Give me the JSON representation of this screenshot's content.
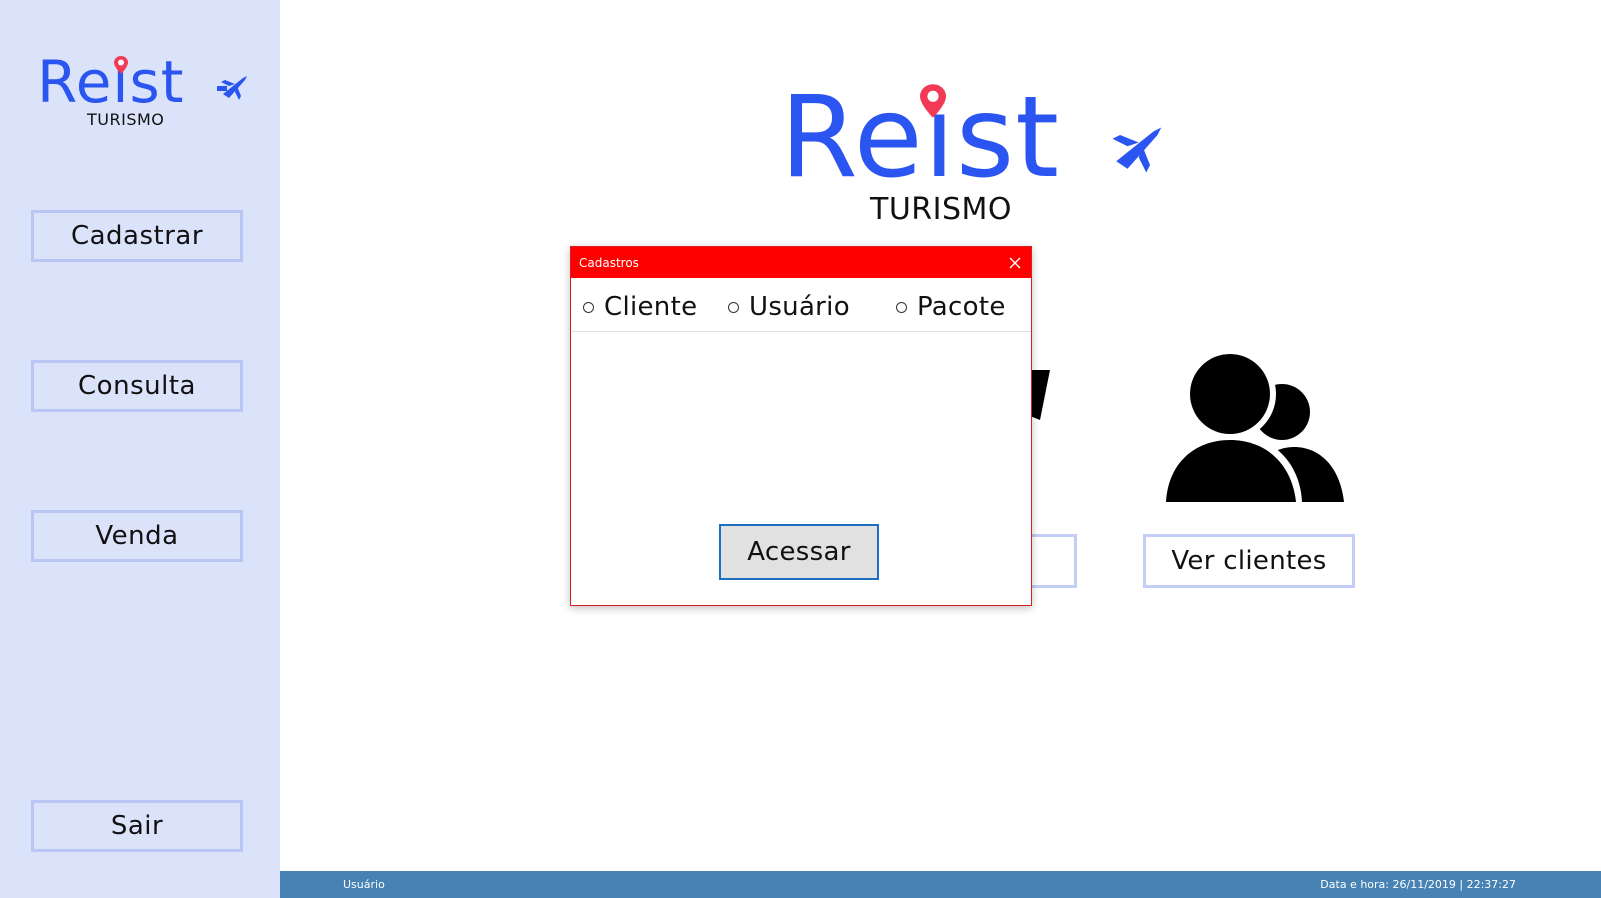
{
  "brand": {
    "name": "Reist",
    "subtitle": "TURISMO",
    "color": "#2a55f0",
    "pin_color": "#f23a57"
  },
  "sidebar": {
    "buttons": [
      {
        "label": "Cadastrar"
      },
      {
        "label": "Consulta"
      },
      {
        "label": "Venda"
      },
      {
        "label": "Sair"
      }
    ]
  },
  "main": {
    "partial_button_label": "",
    "ver_clientes_label": "Ver clientes"
  },
  "dialog": {
    "title": "Cadastros",
    "options": [
      {
        "label": "Cliente",
        "selected": false
      },
      {
        "label": "Usuário",
        "selected": false
      },
      {
        "label": "Pacote",
        "selected": false
      }
    ],
    "access_label": "Acessar",
    "titlebar_color": "#ff0000"
  },
  "statusbar": {
    "user": "Usuário",
    "datetime": "Data e hora: 26/11/2019 | 22:37:27",
    "color": "#4682b4"
  }
}
